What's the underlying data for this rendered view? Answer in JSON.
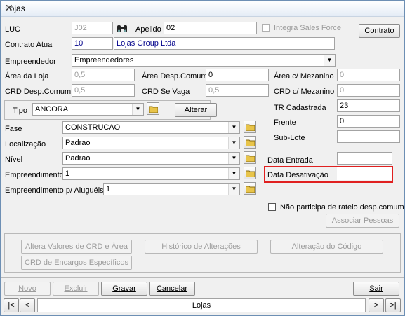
{
  "window": {
    "title": "Lojas",
    "close_glyph": "✕"
  },
  "fields": {
    "luc": {
      "label": "LUC",
      "value": "J02"
    },
    "apelido": {
      "label": "Apelido",
      "value": "02"
    },
    "integra_sales_force": {
      "label": "Integra Sales Force"
    },
    "contrato_atual": {
      "label": "Contrato Atual",
      "value": "10",
      "name": "Lojas Group Ltda"
    },
    "empreendedor": {
      "label": "Empreendedor",
      "value": "Empreendedores"
    },
    "area_loja": {
      "label": "Área da Loja",
      "value": "0,5"
    },
    "area_desp_comum": {
      "label": "Área Desp.Comum",
      "value": "0"
    },
    "area_mezanino": {
      "label": "Área c/ Mezanino",
      "value": "0"
    },
    "crd_desp_comum": {
      "label": "CRD Desp.Comum",
      "value": "0,5"
    },
    "crd_se_vaga": {
      "label": "CRD Se Vaga",
      "value": "0,5"
    },
    "crd_mezanino": {
      "label": "CRD c/ Mezanino",
      "value": "0"
    },
    "tipo": {
      "label": "Tipo",
      "value": "ANCORA"
    },
    "tr_cadastrada": {
      "label": "TR Cadastrada",
      "value": "23"
    },
    "frente": {
      "label": "Frente",
      "value": "0"
    },
    "sub_lote": {
      "label": "Sub-Lote",
      "value": ""
    },
    "fase": {
      "label": "Fase",
      "value": "CONSTRUCAO"
    },
    "localizacao": {
      "label": "Localização",
      "value": "Padrao"
    },
    "nivel": {
      "label": "Nível",
      "value": "Padrao"
    },
    "empreendimento": {
      "label": "Empreendimento",
      "value": "1"
    },
    "empreendimento_alugueis": {
      "label": "Empreendimento p/ Aluguéis",
      "value": "1"
    },
    "data_entrada": {
      "label": "Data Entrada",
      "value": ""
    },
    "data_desativacao": {
      "label": "Data Desativação",
      "value": ""
    },
    "nao_participa": {
      "label": "Não participa de rateio desp.comum"
    }
  },
  "buttons": {
    "contrato": "Contrato",
    "alterar": "Alterar",
    "associar_pessoas": "Associar Pessoas",
    "altera_valores": "Altera Valores de CRD e Área",
    "historico": "Histórico de Alterações",
    "alteracao_codigo": "Alteração do Código",
    "crd_encargos": "CRD de Encargos Específicos",
    "novo": "Novo",
    "excluir": "Excluir",
    "gravar": "Gravar",
    "cancelar": "Cancelar",
    "sair": "Sair"
  },
  "navigator": {
    "first": "|<",
    "prev": "<",
    "caption": "Lojas",
    "next": ">",
    "last": ">|"
  },
  "icons": {
    "binoculars": "binoculars-icon",
    "folder": "folder-icon",
    "dropdown": "▼"
  },
  "colors": {
    "highlight": "#e02020",
    "link_text": "#00008b"
  }
}
